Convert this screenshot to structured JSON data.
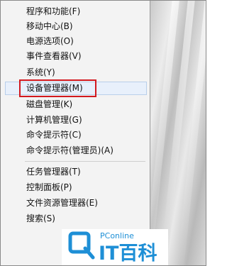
{
  "menu": {
    "items": [
      {
        "label": "程序和功能(F)"
      },
      {
        "label": "移动中心(B)"
      },
      {
        "label": "电源选项(O)"
      },
      {
        "label": "事件查看器(V)"
      },
      {
        "label": "系统(Y)"
      },
      {
        "label": "设备管理器(M)"
      },
      {
        "label": "磁盘管理(K)"
      },
      {
        "label": "计算机管理(G)"
      },
      {
        "label": "命令提示符(C)"
      },
      {
        "label": "命令提示符(管理员)(A)"
      },
      {
        "label": "任务管理器(T)"
      },
      {
        "label": "控制面板(P)"
      },
      {
        "label": "文件资源管理器(E)"
      },
      {
        "label": "搜索(S)"
      }
    ],
    "highlighted_index": 5
  },
  "watermark": {
    "brand_en": "PConline",
    "brand_cn": "IT百科",
    "color": "#1e8fd6"
  },
  "colors": {
    "highlight_box": "#d2191f",
    "hover_bg": "#e8f0fb"
  }
}
